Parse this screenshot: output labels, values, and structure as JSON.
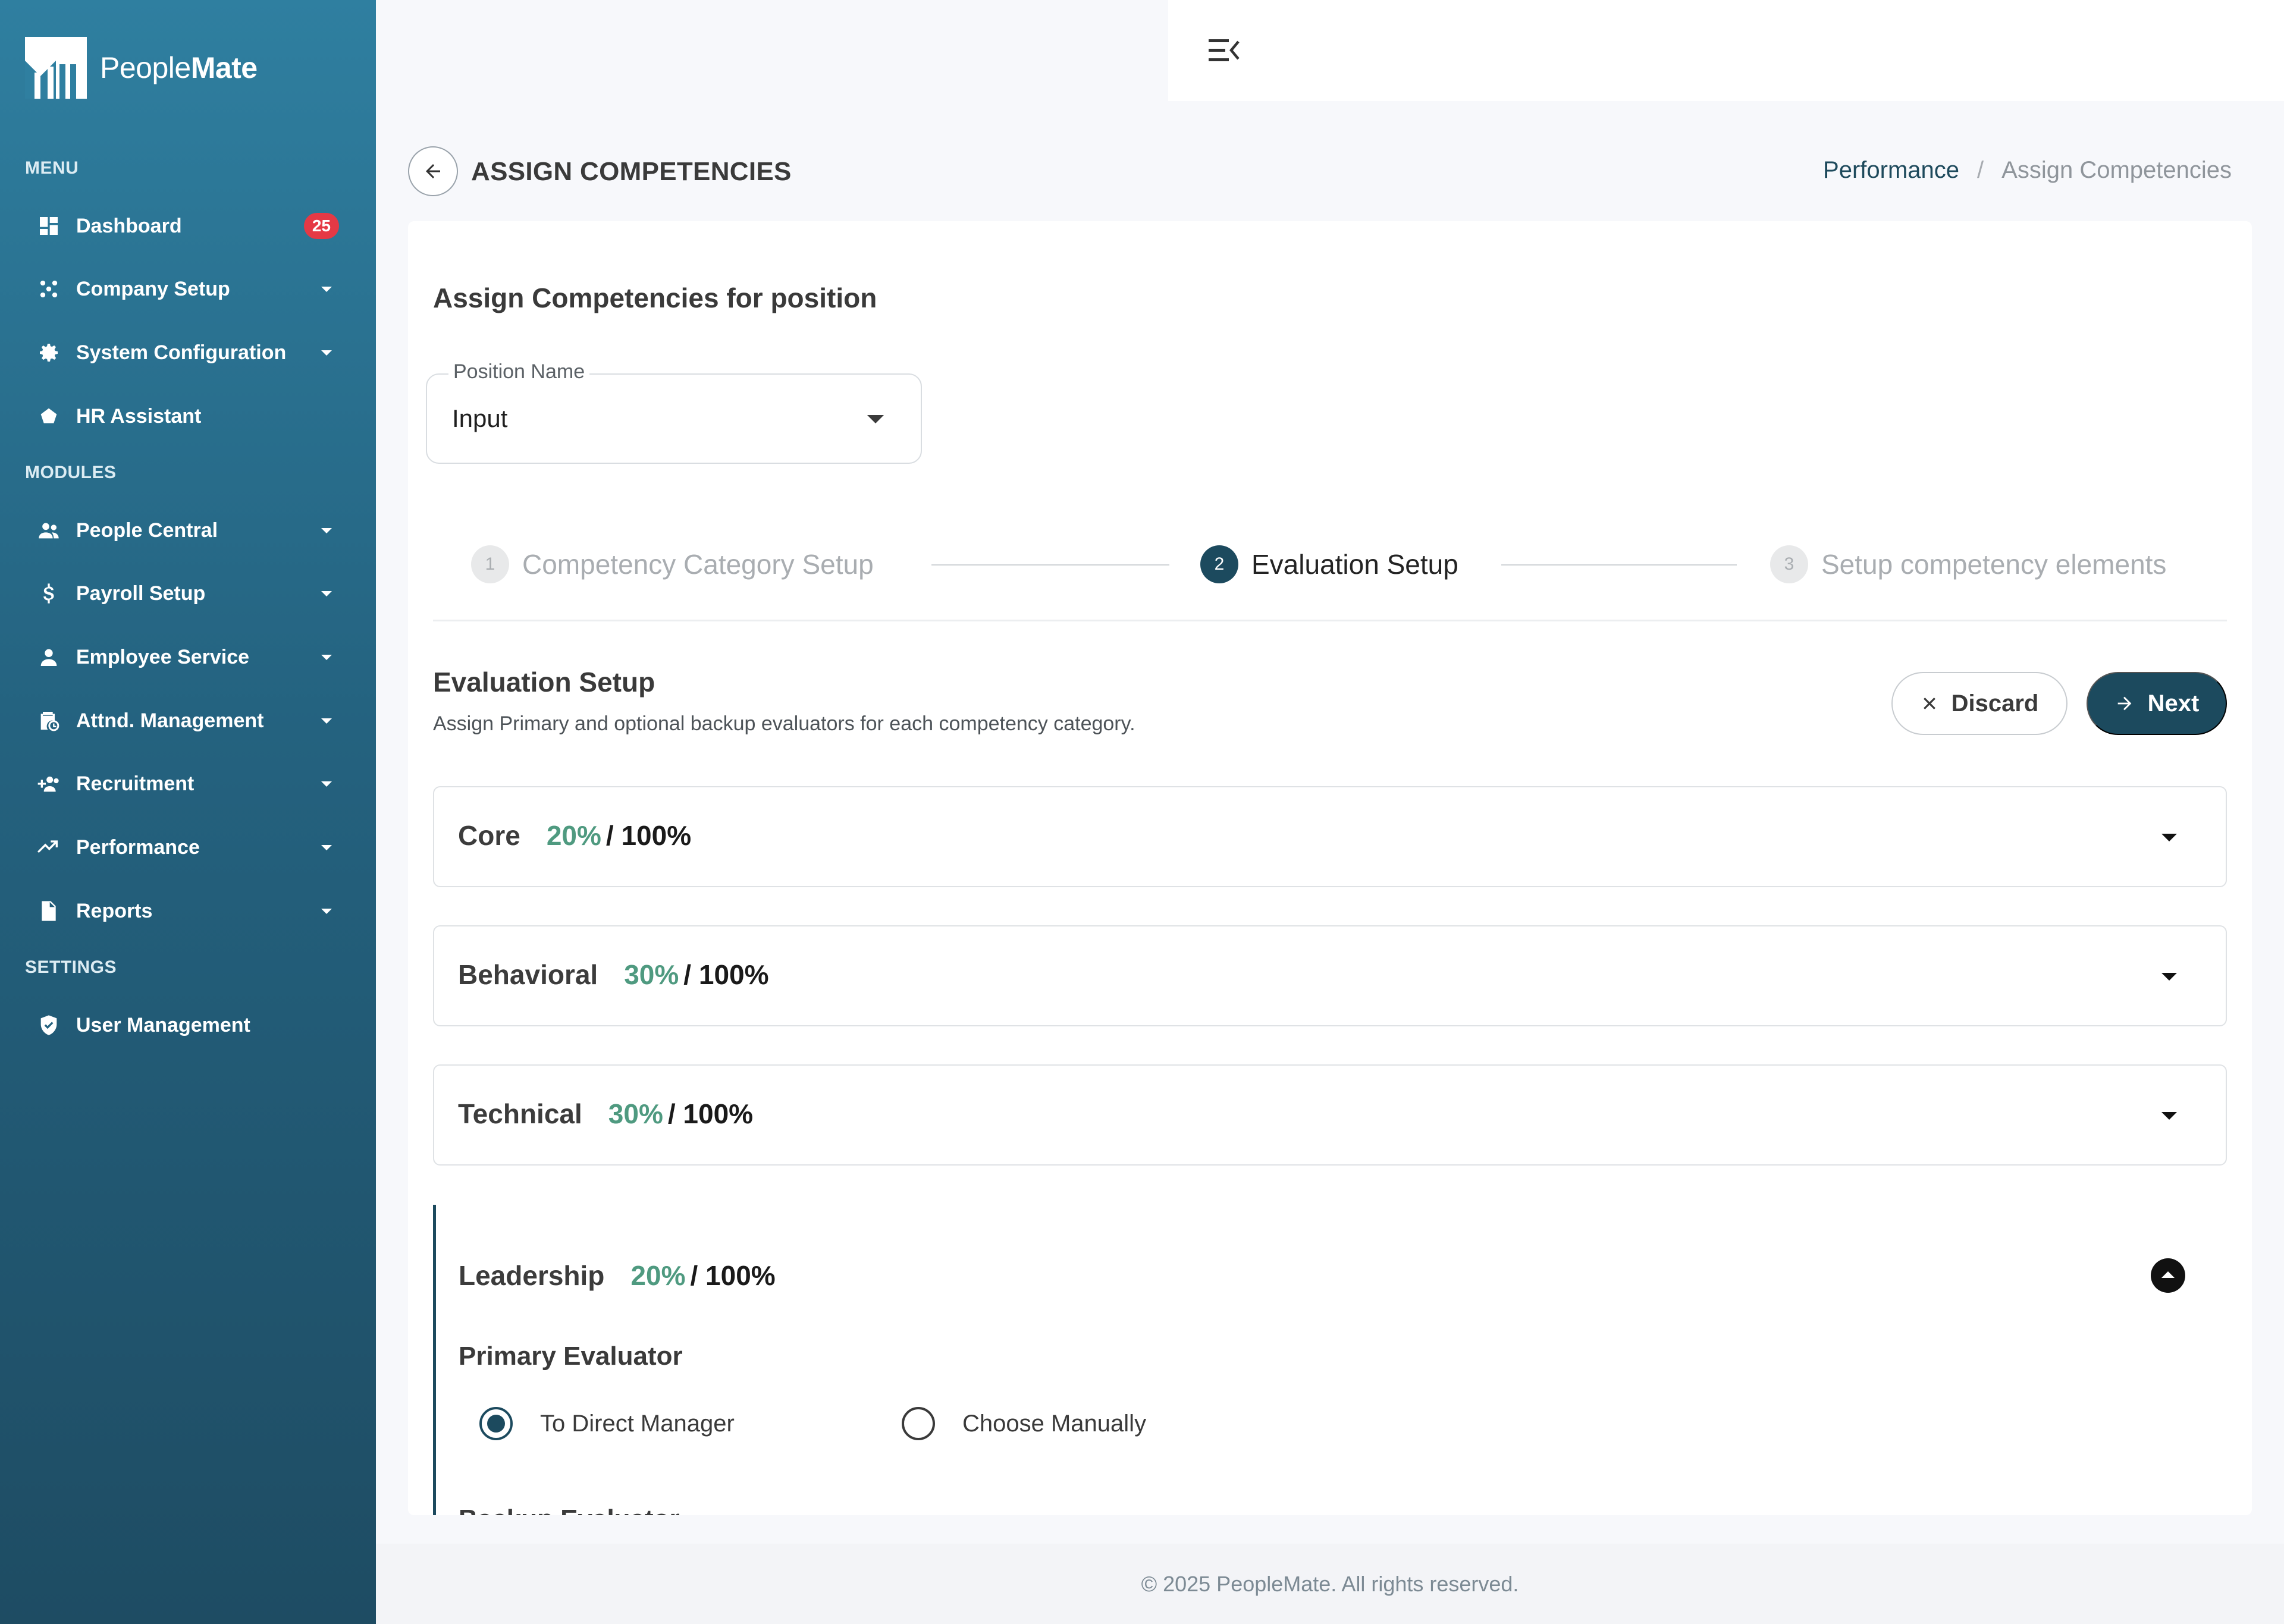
{
  "app": {
    "logo_text_light": "People",
    "logo_text_bold": "Mate"
  },
  "sidebar": {
    "sections": [
      "MENU",
      "MODULES",
      "SETTINGS"
    ],
    "items": [
      {
        "label": "Dashboard",
        "icon": "dashboard-icon",
        "badge": "25"
      },
      {
        "label": "Company Setup",
        "icon": "company-setup-icon",
        "has_submenu": true
      },
      {
        "label": "System Configuration",
        "icon": "gear-icon",
        "has_submenu": true
      },
      {
        "label": "HR Assistant",
        "icon": "assistant-icon"
      },
      {
        "label": "People Central",
        "icon": "people-icon",
        "has_submenu": true
      },
      {
        "label": "Payroll Setup",
        "icon": "dollar-icon",
        "has_submenu": true
      },
      {
        "label": "Employee Service",
        "icon": "person-icon",
        "has_submenu": true
      },
      {
        "label": "Attnd. Management",
        "icon": "attendance-icon",
        "has_submenu": true
      },
      {
        "label": "Recruitment",
        "icon": "recruitment-icon",
        "has_submenu": true
      },
      {
        "label": "Performance",
        "icon": "trend-icon",
        "has_submenu": true
      },
      {
        "label": "Reports",
        "icon": "document-icon",
        "has_submenu": true
      },
      {
        "label": "User Management",
        "icon": "shield-icon"
      }
    ]
  },
  "topbar": {
    "menu_toggle_icon": "menu-collapse-icon"
  },
  "header": {
    "title": "ASSIGN COMPETENCIES",
    "breadcrumb": [
      "Performance",
      "/",
      "Assign Competencies"
    ]
  },
  "form": {
    "card_title": "Assign Competencies for position",
    "position_label": "Position Name",
    "position_value": "Input"
  },
  "stepper": [
    {
      "num": "1",
      "label": "Competency Category Setup",
      "state": "inactive"
    },
    {
      "num": "2",
      "label": "Evaluation Setup",
      "state": "active"
    },
    {
      "num": "3",
      "label": "Setup competency elements",
      "state": "inactive"
    }
  ],
  "evaluation": {
    "title": "Evaluation Setup",
    "description": "Assign Primary and optional backup evaluators for each competency category.",
    "discard_label": "Discard",
    "next_label": "Next"
  },
  "categories": [
    {
      "name": "Core",
      "pct": "20%",
      "total": "/ 100%",
      "expanded": false
    },
    {
      "name": "Behavioral",
      "pct": "30%",
      "total": "/ 100%",
      "expanded": false
    },
    {
      "name": "Technical",
      "pct": "30%",
      "total": "/ 100%",
      "expanded": false
    },
    {
      "name": "Leadership",
      "pct": "20%",
      "total": "/ 100%",
      "expanded": true
    }
  ],
  "leadership": {
    "primary_title": "Primary Evaluator",
    "options": [
      {
        "label": "To Direct Manager",
        "checked": true
      },
      {
        "label": "Choose Manually",
        "checked": false
      }
    ],
    "backup_title": "Backup Evaluator"
  },
  "colors": {
    "accent": "#1c4a5e",
    "percent": "#4f9a80",
    "badge": "#e53945"
  },
  "footer": {
    "text": "© 2025  PeopleMate. All rights reserved."
  }
}
